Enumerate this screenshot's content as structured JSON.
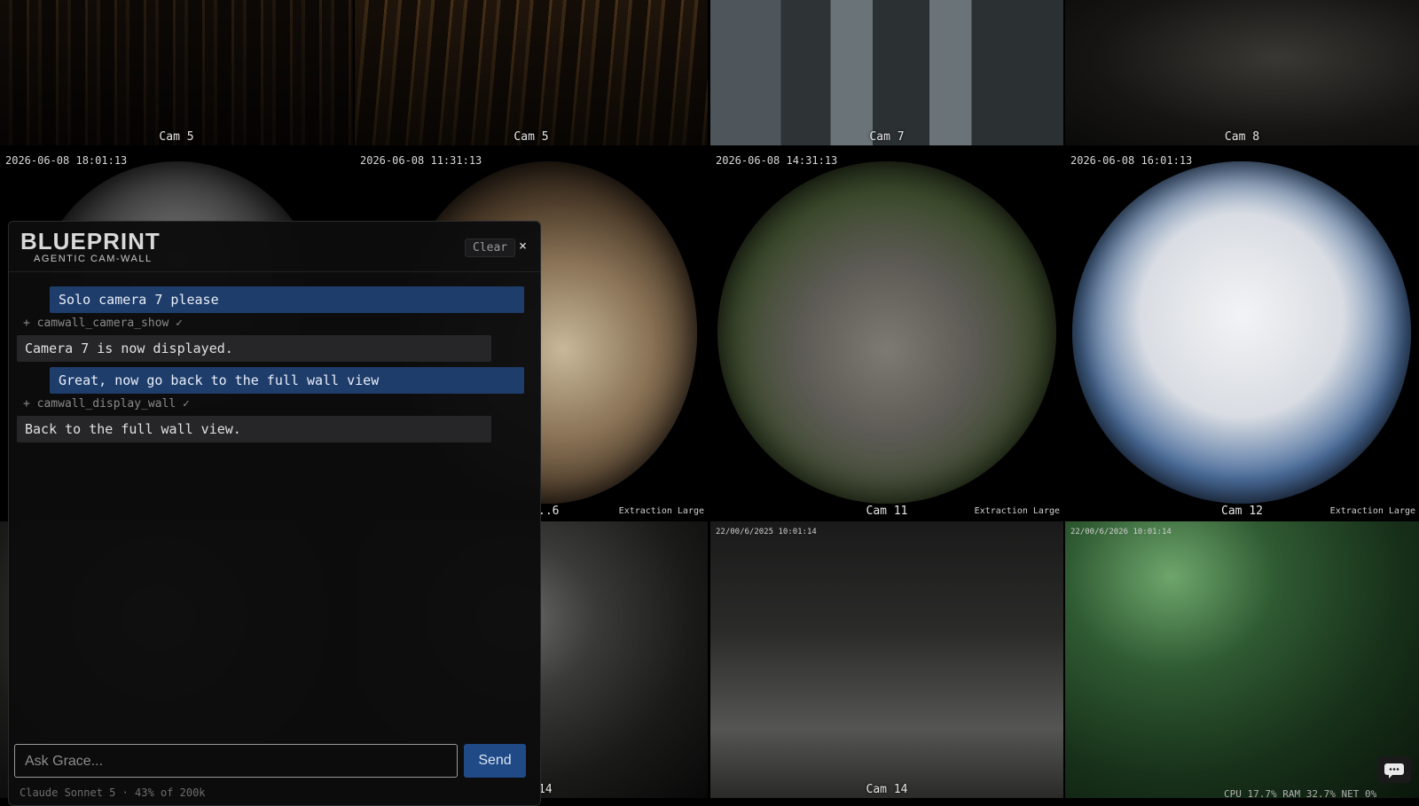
{
  "wall": {
    "row1": [
      {
        "label": "Cam 5"
      },
      {
        "label": "Cam 5"
      },
      {
        "label": "Cam 7"
      },
      {
        "label": "Cam 8"
      }
    ],
    "row2": [
      {
        "timestamp": "2026-06-08 18:01:13",
        "label": "",
        "quality": ""
      },
      {
        "timestamp": "2026-06-08 11:31:13",
        "label": "..6",
        "quality": "Extraction Large"
      },
      {
        "timestamp": "2026-06-08 14:31:13",
        "label": "Cam 11",
        "quality": "Extraction Large"
      },
      {
        "timestamp": "2026-06-08 16:01:13",
        "label": "Cam 12",
        "quality": "Extraction Large"
      }
    ],
    "row3": [
      {
        "timestamp": "",
        "label": ""
      },
      {
        "timestamp": "",
        "label": "14"
      },
      {
        "timestamp": "22/00/6/2025 10:01:14",
        "label": "Cam 14"
      },
      {
        "timestamp": "22/00/6/2026 10:01:14",
        "label": ""
      }
    ],
    "sysinfo": "CPU 17.7% RAM 32.7% NET 0%"
  },
  "chat": {
    "logo": "BLUEPRINT",
    "logo_sub": "AGENTIC CAM-WALL",
    "clear_label": "Clear",
    "close_glyph": "×",
    "messages": [
      {
        "role": "user",
        "text": "Solo camera 7 please"
      },
      {
        "role": "tool",
        "text": "+ camwall_camera_show ✓"
      },
      {
        "role": "assistant",
        "text": "Camera 7 is now displayed."
      },
      {
        "role": "user",
        "text": "Great, now go back to the full wall view"
      },
      {
        "role": "tool",
        "text": "+ camwall_display_wall ✓"
      },
      {
        "role": "assistant",
        "text": "Back to the full wall view."
      }
    ],
    "input_placeholder": "Ask Grace...",
    "send_label": "Send",
    "status": "Claude Sonnet 5 · 43% of 200k"
  },
  "icons": {
    "floating_chat": "chat-bubble-icon"
  }
}
